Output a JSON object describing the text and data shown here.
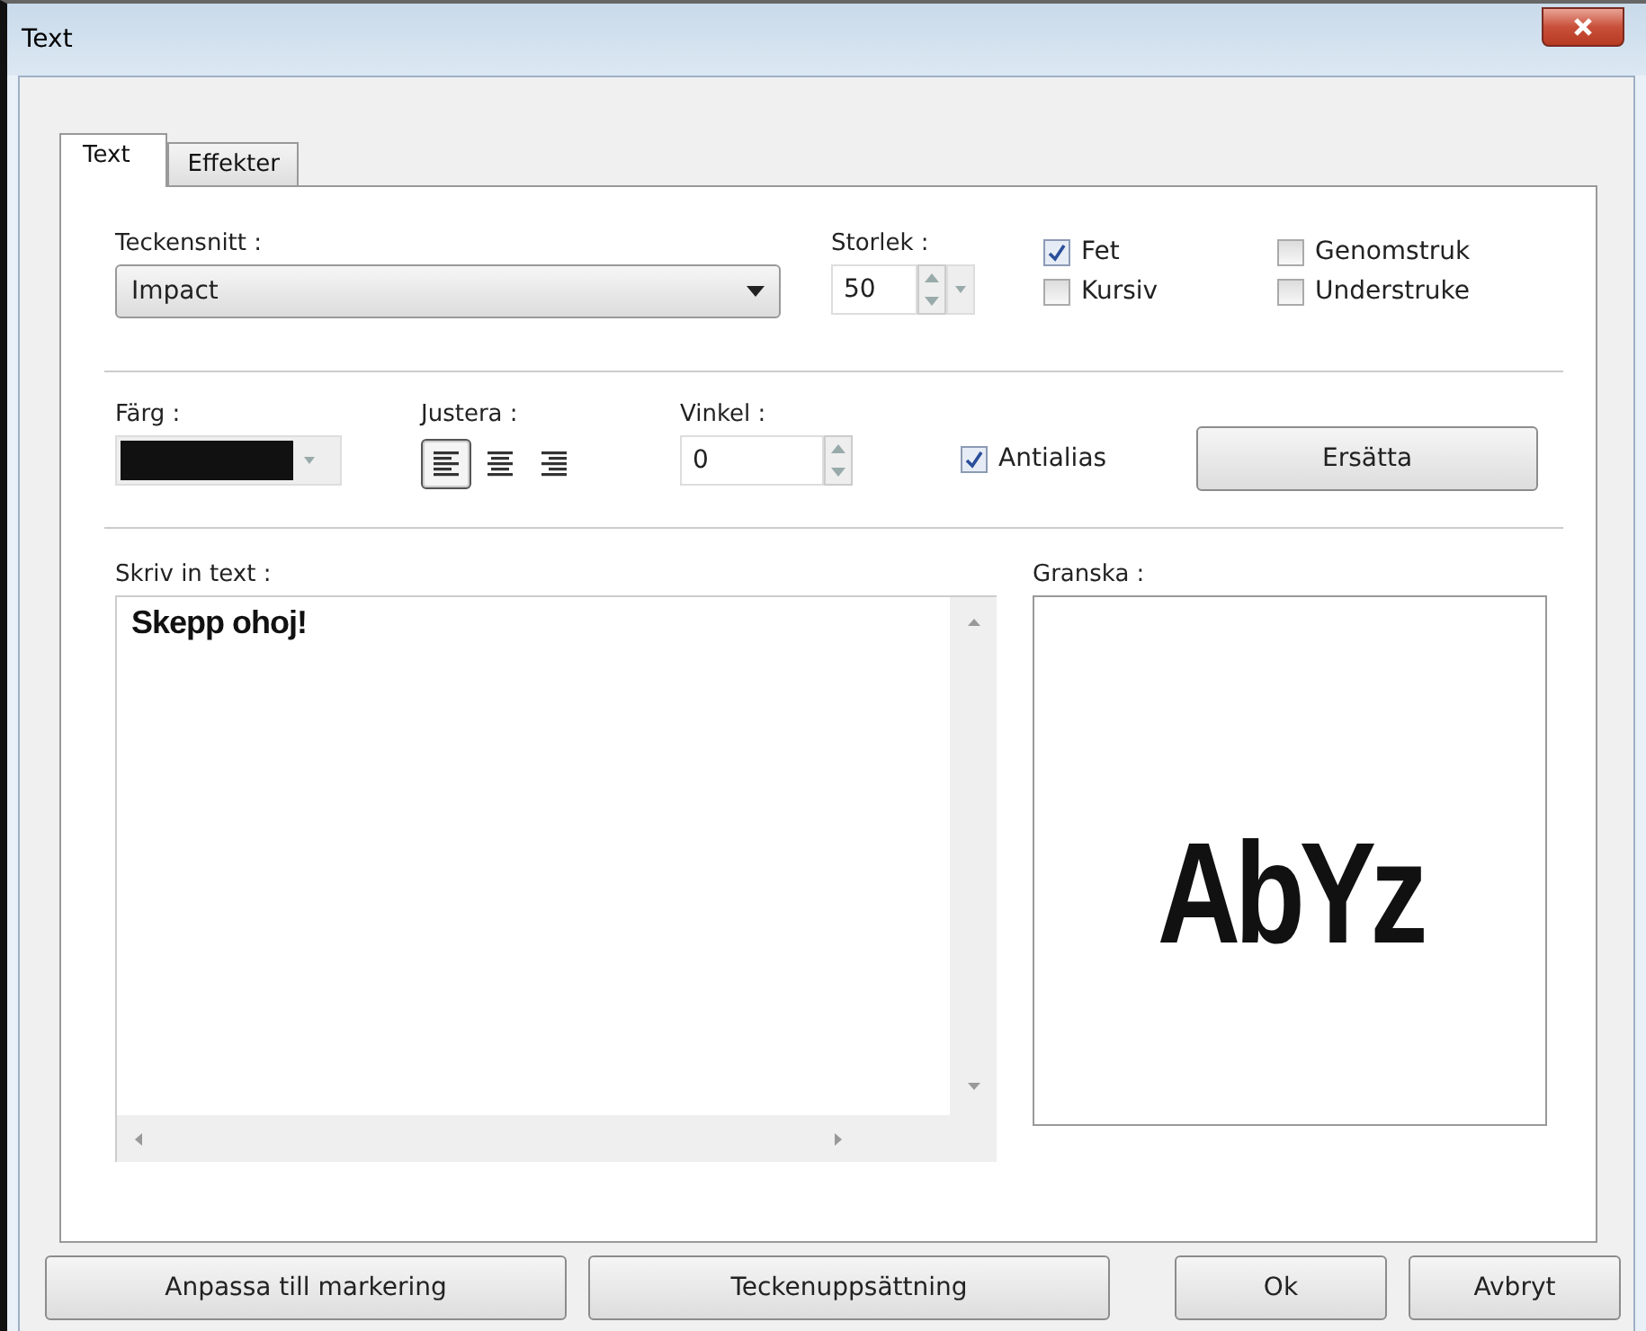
{
  "window": {
    "title": "Text"
  },
  "tabs": [
    {
      "label": "Text",
      "selected": true
    },
    {
      "label": "Effekter",
      "selected": false
    }
  ],
  "font": {
    "label": "Teckensnitt :",
    "value": "Impact"
  },
  "size": {
    "label": "Storlek :",
    "value": "50"
  },
  "styles": [
    {
      "label": "Fet",
      "checked": true
    },
    {
      "label": "Kursiv",
      "checked": false
    },
    {
      "label": "Genomstruk",
      "checked": false
    },
    {
      "label": "Understruke",
      "checked": false
    }
  ],
  "color": {
    "label": "Färg :",
    "color": "#111111"
  },
  "align": {
    "label": "Justera :",
    "options": [
      {
        "kind": "left",
        "selected": true
      },
      {
        "kind": "center",
        "selected": false
      },
      {
        "kind": "right",
        "selected": false
      }
    ]
  },
  "angle": {
    "label": "Vinkel :",
    "value": "0"
  },
  "antialias": {
    "label": "Antialias",
    "checked": true
  },
  "replace_button": "Ersätta",
  "text_input": {
    "label": "Skriv in text :",
    "value": "Skepp ohoj!"
  },
  "preview": {
    "label": "Granska :",
    "sample": "AbYz"
  },
  "buttons": [
    "Anpassa till markering",
    "Teckenuppsättning",
    "Ok",
    "Avbryt"
  ]
}
